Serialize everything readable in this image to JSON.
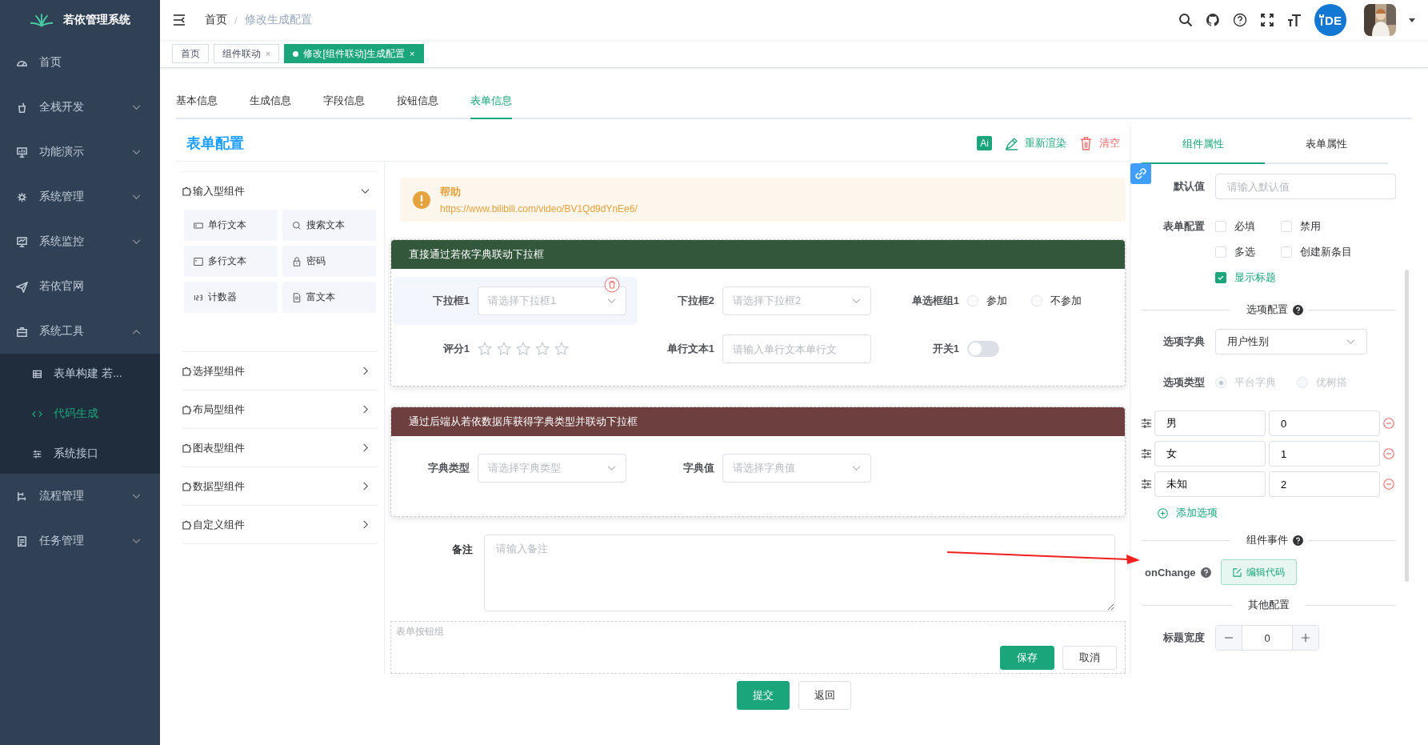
{
  "sidebar": {
    "logo_title": "若依管理系统",
    "items": [
      {
        "label": "首页",
        "kind": "link"
      },
      {
        "label": "全栈开发",
        "kind": "group",
        "expanded": false
      },
      {
        "label": "功能演示",
        "kind": "group",
        "expanded": false
      },
      {
        "label": "系统管理",
        "kind": "group",
        "expanded": false
      },
      {
        "label": "系统监控",
        "kind": "group",
        "expanded": false
      },
      {
        "label": "若依官网",
        "kind": "link"
      },
      {
        "label": "系统工具",
        "kind": "group",
        "expanded": true,
        "children": [
          {
            "label": "表单构建 若...",
            "selected": false
          },
          {
            "label": "代码生成",
            "selected": true
          },
          {
            "label": "系统接口",
            "selected": false
          }
        ]
      },
      {
        "label": "流程管理",
        "kind": "group",
        "expanded": false
      },
      {
        "label": "任务管理",
        "kind": "group",
        "expanded": false
      }
    ]
  },
  "header": {
    "breadcrumb": [
      "首页",
      "修改生成配置"
    ],
    "separator": "/",
    "ide_badge": "DE"
  },
  "tags": [
    {
      "label": "首页",
      "selected": false
    },
    {
      "label": "组件联动",
      "selected": false,
      "close": "×"
    },
    {
      "label": "修改[组件联动]生成配置",
      "selected": true,
      "close": "×"
    }
  ],
  "tabs": [
    {
      "label": "基本信息",
      "selected": false
    },
    {
      "label": "生成信息",
      "selected": false
    },
    {
      "label": "字段信息",
      "selected": false
    },
    {
      "label": "按钮信息",
      "selected": false
    },
    {
      "label": "表单信息",
      "selected": true
    }
  ],
  "designer": {
    "title": "表单配置",
    "toolbar": [
      {
        "kind": "ai",
        "label": "Ai"
      },
      {
        "kind": "render",
        "label": "重新渲染"
      },
      {
        "kind": "clear",
        "label": "清空"
      }
    ],
    "palette": [
      {
        "label": "输入型组件",
        "expanded": true,
        "items": [
          {
            "label": "单行文本"
          },
          {
            "label": "搜索文本"
          },
          {
            "label": "多行文本"
          },
          {
            "label": "密码"
          },
          {
            "label": "计数器"
          },
          {
            "label": "富文本"
          }
        ]
      },
      {
        "label": "选择型组件",
        "expanded": false
      },
      {
        "label": "布局型组件",
        "expanded": false
      },
      {
        "label": "图表型组件",
        "expanded": false
      },
      {
        "label": "数据型组件",
        "expanded": false
      },
      {
        "label": "自定义组件",
        "expanded": false
      }
    ],
    "alert": {
      "title": "帮助",
      "link": "https://www.bilibili.com/video/BV1Qd9dYnEe6/"
    },
    "cards": [
      {
        "title": "直接通过若依字典联动下拉框",
        "color": "#33573b",
        "fields": [
          {
            "kind": "select",
            "label": "下拉框1",
            "placeholder": "请选择下拉框1",
            "selected": true
          },
          {
            "kind": "select",
            "label": "下拉框2",
            "placeholder": "请选择下拉框2",
            "selected": false
          },
          {
            "kind": "radio",
            "label": "单选框组1",
            "options": [
              {
                "label": "参加",
                "selected": false
              },
              {
                "label": "不参加",
                "selected": false
              }
            ],
            "selected": false
          },
          {
            "kind": "rate",
            "label": "评分1",
            "stars": 0,
            "selected": false
          },
          {
            "kind": "input",
            "label": "单行文本1",
            "placeholder": "请输入单行文本单行文",
            "selected": false
          },
          {
            "kind": "switch",
            "label": "开关1",
            "on": false,
            "selected": false
          }
        ]
      },
      {
        "title": "通过后端从若依数据库获得字典类型并联动下拉框",
        "color": "#6e3f3f",
        "fields": [
          {
            "kind": "select",
            "label": "字典类型",
            "placeholder": "请选择字典类型",
            "selected": false
          },
          {
            "kind": "select",
            "label": "字典值",
            "placeholder": "请选择字典值",
            "selected": false
          }
        ]
      }
    ],
    "remark": {
      "label": "备注",
      "placeholder": "请输入备注"
    },
    "button_group": {
      "label": "表单按钮组",
      "buttons": [
        {
          "label": "保存",
          "primary": true
        },
        {
          "label": "取消",
          "primary": false
        }
      ]
    }
  },
  "footer_buttons": [
    {
      "label": "提交",
      "primary": true
    },
    {
      "label": "返回",
      "primary": false
    }
  ],
  "properties": {
    "tabs": [
      {
        "label": "组件属性",
        "selected": true
      },
      {
        "label": "表单属性",
        "selected": false
      }
    ],
    "default_value": {
      "label": "默认值",
      "placeholder": "请输入默认值"
    },
    "form_config": {
      "label": "表单配置",
      "checkboxes": [
        {
          "label": "必填",
          "checked": false
        },
        {
          "label": "禁用",
          "checked": false
        },
        {
          "label": "多选",
          "checked": false
        },
        {
          "label": "创建新条目",
          "checked": false
        },
        {
          "label": "显示标题",
          "checked": true
        }
      ]
    },
    "options_section": "选项配置",
    "dict": {
      "label": "选项字典",
      "value": "用户性别"
    },
    "option_type": {
      "label": "选项类型",
      "options": [
        {
          "label": "平台字典",
          "selected": true,
          "disabled": true
        },
        {
          "label": "优树搭",
          "selected": false,
          "disabled": true
        }
      ]
    },
    "options": [
      {
        "label": "男",
        "value": "0"
      },
      {
        "label": "女",
        "value": "1"
      },
      {
        "label": "未知",
        "value": "2"
      }
    ],
    "add_option": "添加选项",
    "events_section": "组件事件",
    "event": {
      "label": "onChange",
      "button": "编辑代码"
    },
    "other_section": "其他配置",
    "title_width": {
      "label": "标题宽度",
      "value": "0"
    }
  }
}
